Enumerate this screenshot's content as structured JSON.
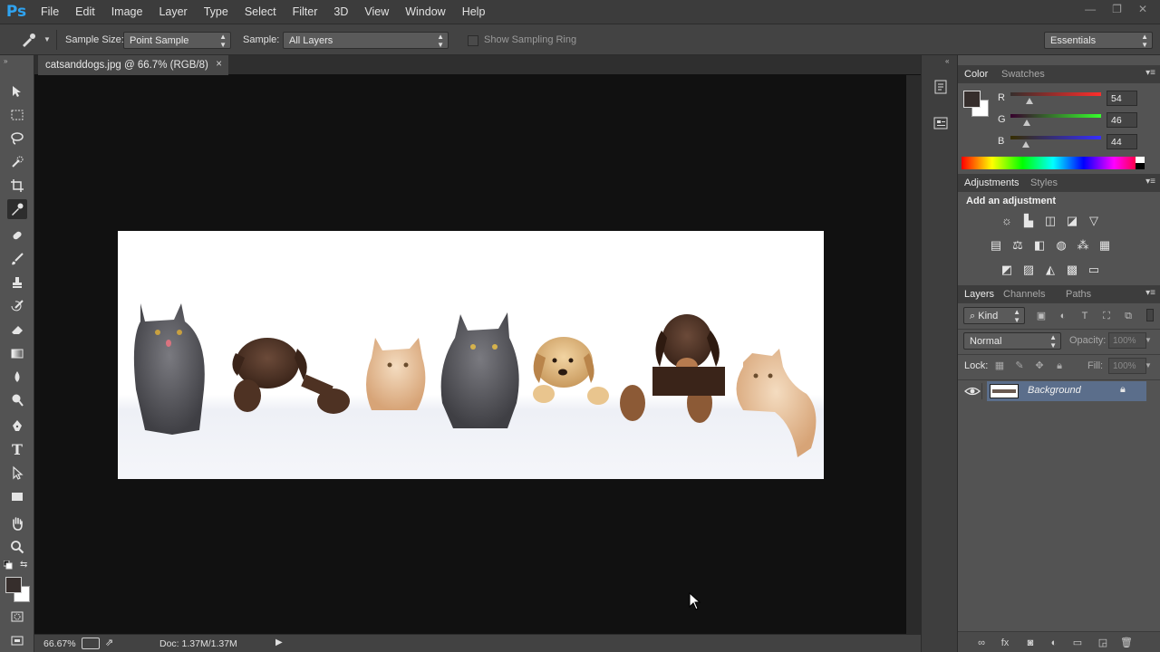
{
  "app": {
    "logo": "Ps"
  },
  "menu": [
    "File",
    "Edit",
    "Image",
    "Layer",
    "Type",
    "Select",
    "Filter",
    "3D",
    "View",
    "Window",
    "Help"
  ],
  "window_controls": [
    "—",
    "❐",
    "✕"
  ],
  "options": {
    "sample_size_label": "Sample Size:",
    "sample_size_value": "Point Sample",
    "sample_label": "Sample:",
    "sample_value": "All Layers",
    "show_sampling_ring": "Show Sampling Ring",
    "workspace": "Essentials"
  },
  "document": {
    "tab_title": "catsanddogs.jpg @ 66.7% (RGB/8)",
    "close": "×"
  },
  "status": {
    "zoom": "66.67%",
    "doc": "Doc: 1.37M/1.37M"
  },
  "color_panel": {
    "tabs": [
      "Color",
      "Swatches"
    ],
    "r_label": "R",
    "r_value": "54",
    "g_label": "G",
    "g_value": "46",
    "b_label": "B",
    "b_value": "44",
    "r": 54,
    "g": 46,
    "b": 44
  },
  "adjustments_panel": {
    "tabs": [
      "Adjustments",
      "Styles"
    ],
    "heading": "Add an adjustment"
  },
  "layers_panel": {
    "tabs": [
      "Layers",
      "Channels",
      "Paths"
    ],
    "kind": "Kind",
    "blend_mode": "Normal",
    "opacity_label": "Opacity:",
    "opacity_value": "100%",
    "lock_label": "Lock:",
    "fill_label": "Fill:",
    "fill_value": "100%",
    "layer_name": "Background"
  },
  "colors": {
    "accent_ps": "#2fa3f0",
    "foreground": "#362e2c",
    "background": "#ffffff"
  }
}
